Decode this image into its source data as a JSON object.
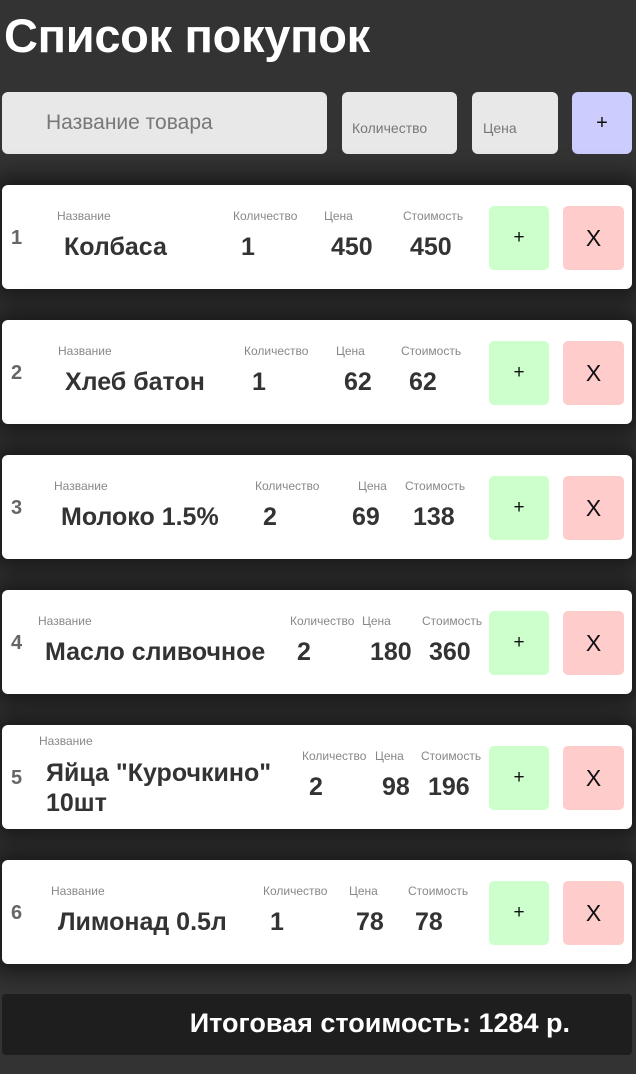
{
  "title": "Список покупок",
  "form": {
    "name_placeholder": "Название товара",
    "qty_placeholder": "Количество",
    "price_placeholder": "Цена",
    "add_label": "+"
  },
  "captions": {
    "name": "Название",
    "qty": "Количество",
    "price": "Цена",
    "cost": "Стоимость"
  },
  "buttons": {
    "increment": "+",
    "delete": "X"
  },
  "items": [
    {
      "num": "1",
      "name": "Колбаса",
      "qty": "1",
      "price": "450",
      "cost": "450"
    },
    {
      "num": "2",
      "name": "Хлеб батон",
      "qty": "1",
      "price": "62",
      "cost": "62"
    },
    {
      "num": "3",
      "name": "Молоко 1.5%",
      "qty": "2",
      "price": "69",
      "cost": "138"
    },
    {
      "num": "4",
      "name": "Масло сливочное",
      "qty": "2",
      "price": "180",
      "cost": "360"
    },
    {
      "num": "5",
      "name": "Яйца \"Курочкино\" 10шт",
      "qty": "2",
      "price": "98",
      "cost": "196"
    },
    {
      "num": "6",
      "name": "Лимонад 0.5л",
      "qty": "1",
      "price": "78",
      "cost": "78"
    }
  ],
  "total": {
    "text": "Итоговая стоимость: 1284 р."
  },
  "colors": {
    "background": "#333333",
    "add_button": "#ccccff",
    "increment_button": "#ccffcc",
    "delete_button": "#ffcccc",
    "total_bar": "#1e1e1e"
  }
}
